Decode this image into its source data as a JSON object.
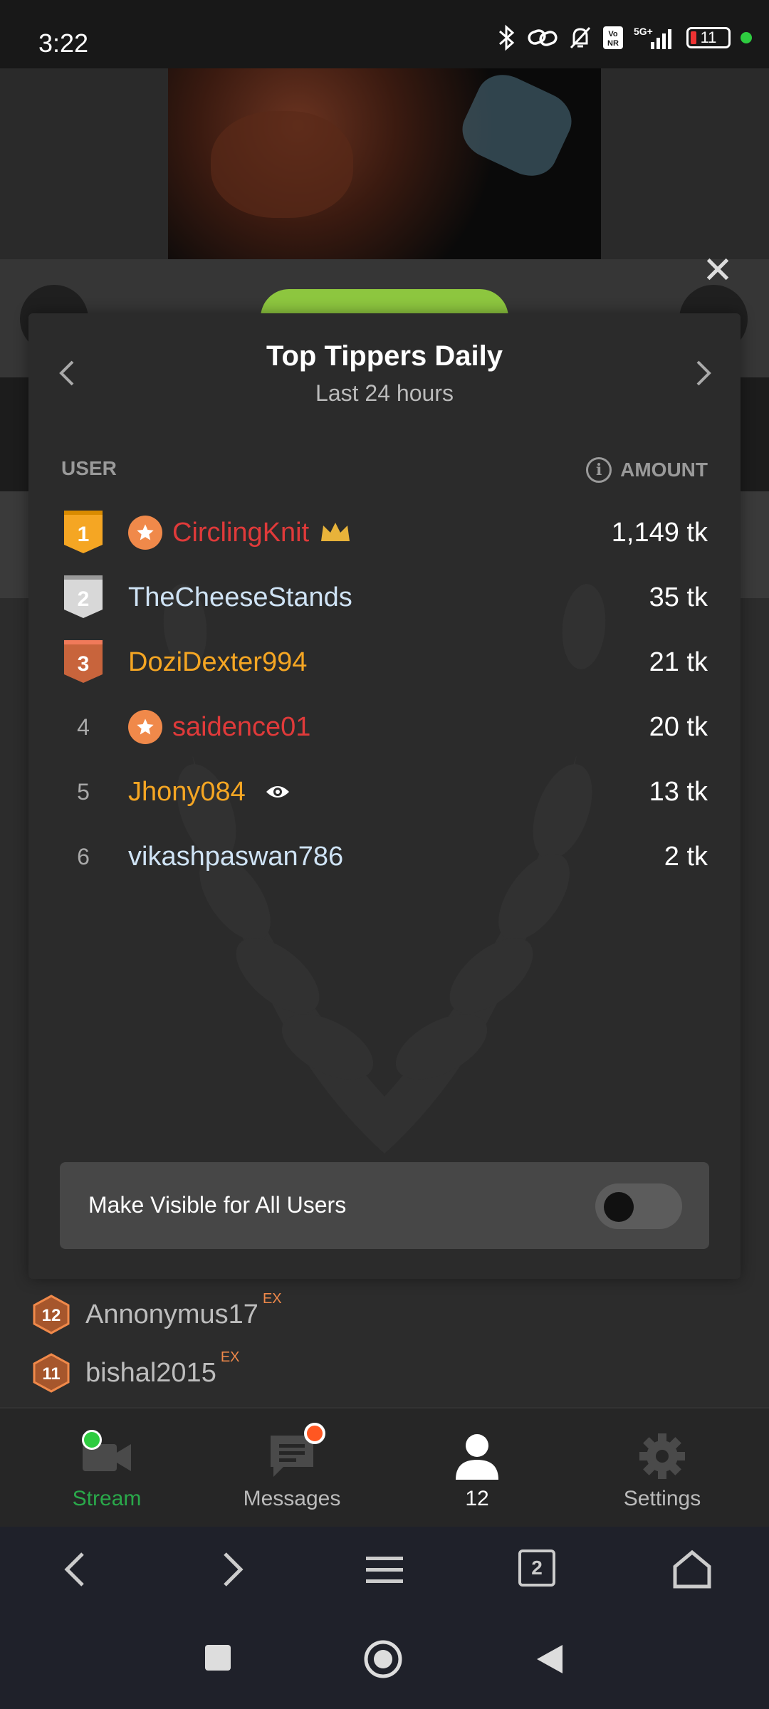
{
  "status_bar": {
    "time": "3:22",
    "battery": "11",
    "network": "5G+"
  },
  "modal": {
    "title": "Top Tippers Daily",
    "subtitle": "Last 24 hours",
    "col_user": "USER",
    "col_amount": "AMOUNT",
    "rows": [
      {
        "rank": "1",
        "user": "CirclingKnit",
        "amount": "1,149 tk",
        "color": "#e03a3a"
      },
      {
        "rank": "2",
        "user": "TheCheeseStands",
        "amount": "35 tk",
        "color": "#cfe3f5"
      },
      {
        "rank": "3",
        "user": "DoziDexter994",
        "amount": "21 tk",
        "color": "#f5a623"
      },
      {
        "rank": "4",
        "user": "saidence01",
        "amount": "20 tk",
        "color": "#e03a3a"
      },
      {
        "rank": "5",
        "user": "Jhony084",
        "amount": "13 tk",
        "color": "#f5a623"
      },
      {
        "rank": "6",
        "user": "vikashpaswan786",
        "amount": "2 tk",
        "color": "#cfe3f5"
      }
    ],
    "toggle_label": "Make Visible for All Users",
    "toggle_on": false
  },
  "list_below": [
    {
      "level": "12",
      "user": "Annonymus17",
      "tag": "EX"
    },
    {
      "level": "11",
      "user": "bishal2015",
      "tag": "EX"
    }
  ],
  "tabbar": {
    "stream": "Stream",
    "messages": "Messages",
    "users": "12",
    "settings": "Settings"
  },
  "browser": {
    "tab_count": "2"
  },
  "colors": {
    "accent_green": "#2ecc40",
    "gold": "#f5a623",
    "silver": "#d8d8d8",
    "bronze": "#c8643c",
    "stream_tab": "#2aa84a"
  }
}
